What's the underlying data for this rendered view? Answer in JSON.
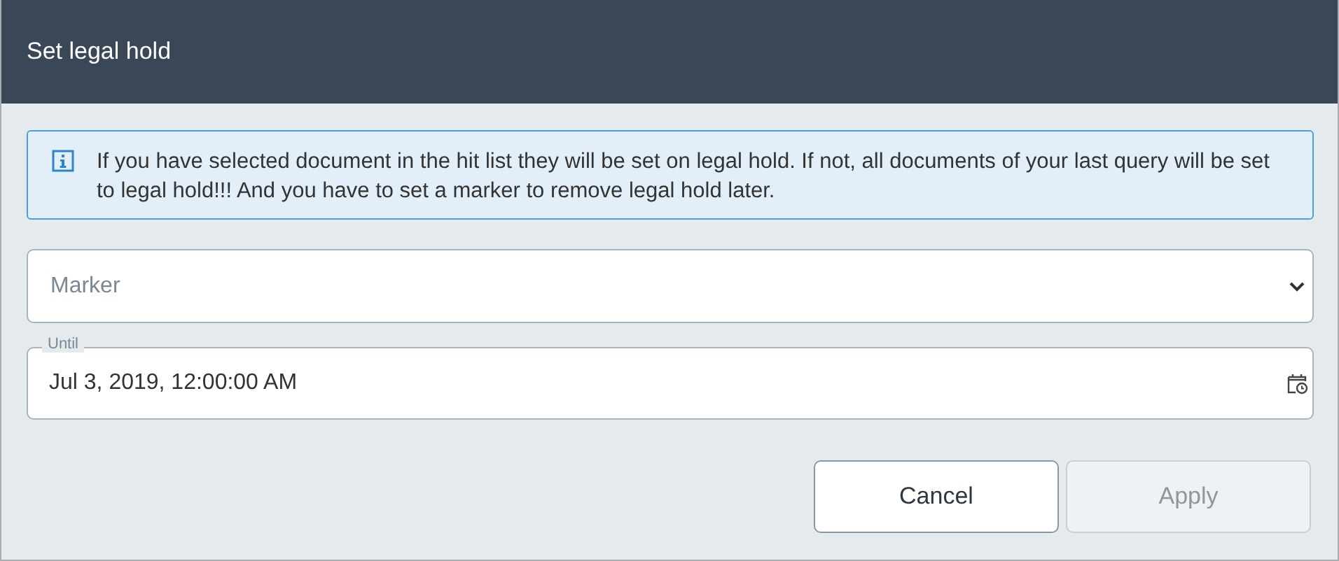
{
  "dialog": {
    "title": "Set legal hold"
  },
  "info": {
    "text": "If you have selected document in the hit list they will be set on legal hold. If not, all documents of your last query will be set to legal hold!!! And you have to set a marker to remove legal hold later."
  },
  "marker_select": {
    "placeholder": "Marker"
  },
  "until_field": {
    "label": "Until",
    "value": "Jul 3, 2019, 12:00:00 AM"
  },
  "buttons": [
    {
      "label": "Cancel",
      "disabled": false
    },
    {
      "label": "Apply",
      "disabled": true
    }
  ]
}
